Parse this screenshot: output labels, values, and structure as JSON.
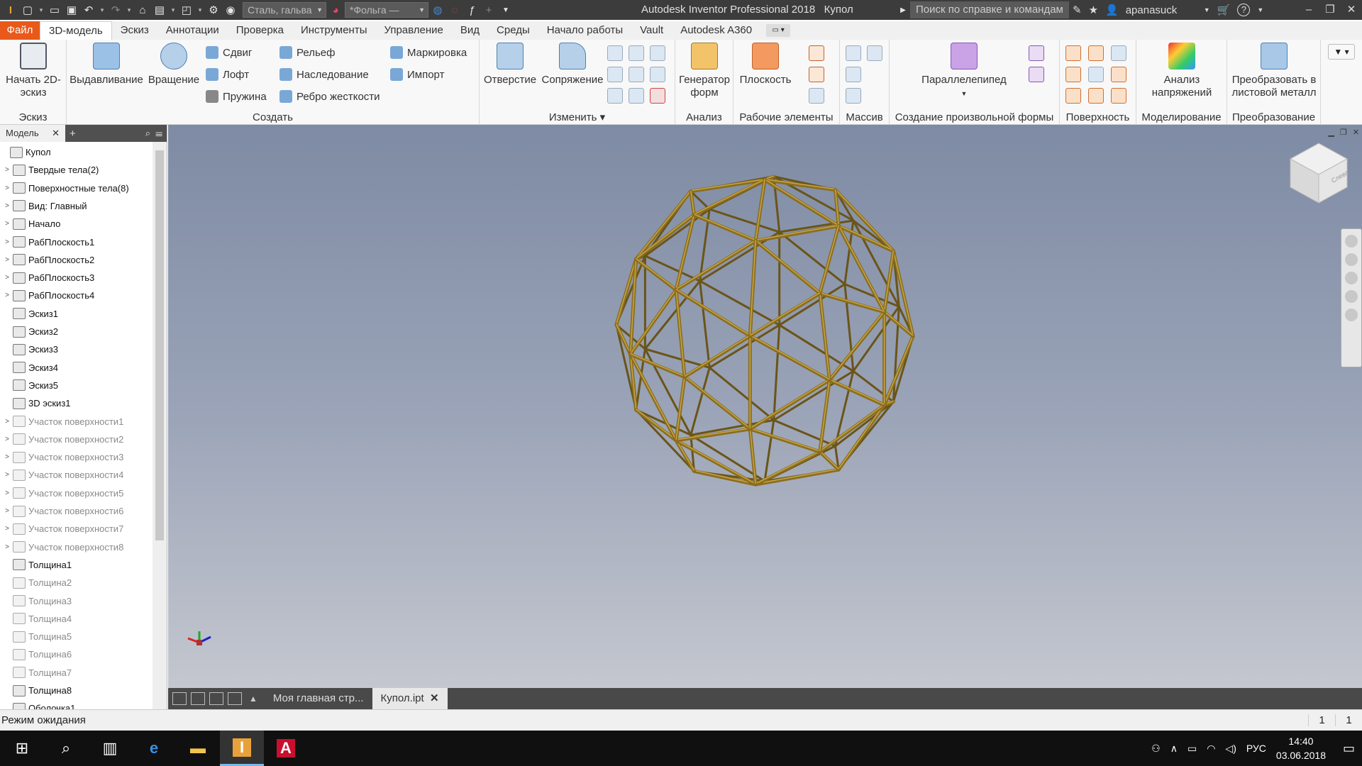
{
  "titlebar": {
    "app_title": "Autodesk Inventor Professional 2018",
    "document": "Купол",
    "material": "Сталь, гальва",
    "appearance": "*Фольга —",
    "search_placeholder": "Поиск по справке и командам",
    "user": "apanasuck",
    "help": "?",
    "quick_access_icons": [
      "new-icon",
      "open-icon",
      "save-icon",
      "undo-icon",
      "redo-icon",
      "home-icon",
      "folder-icon",
      "ilogic-icon",
      "update-icon",
      "globe-icon"
    ]
  },
  "menu": {
    "tabs": [
      "Файл",
      "3D-модель",
      "Эскиз",
      "Аннотации",
      "Проверка",
      "Инструменты",
      "Управление",
      "Вид",
      "Среды",
      "Начало работы",
      "Vault",
      "Autodesk A360"
    ],
    "active_tab": "3D-модель"
  },
  "ribbon": {
    "sketch_panel": {
      "title": "Эскиз",
      "start_2d": "Начать 2D-эскиз"
    },
    "create_panel": {
      "title": "Создать",
      "extrude": "Выдавливание",
      "revolve": "Вращение",
      "small": [
        "Сдвиг",
        "Лофт",
        "Пружина",
        "Рельеф",
        "Наследование",
        "Ребро жесткости",
        "Маркировка",
        "Импорт"
      ]
    },
    "modify_panel": {
      "title": "Изменить",
      "hole": "Отверстие",
      "fillet": "Сопряжение"
    },
    "analysis_panel": {
      "title": "Анализ",
      "shape_generator": "Генератор форм"
    },
    "work_features_panel": {
      "title": "Рабочие элементы",
      "plane": "Плоскость"
    },
    "pattern_panel": {
      "title": "Массив"
    },
    "freeform_panel": {
      "title": "Создание произвольной формы",
      "box": "Параллелепипед"
    },
    "surface_panel": {
      "title": "Поверхность"
    },
    "simulation_panel": {
      "title": "Моделирование",
      "stress": "Анализ напряжений"
    },
    "convert_panel": {
      "title": "Преобразование",
      "sheet_metal": "Преобразовать в листовой металл"
    }
  },
  "browser": {
    "tab": "Модель",
    "items": [
      {
        "label": "Купол",
        "grey": false,
        "expand": false,
        "indent": 0
      },
      {
        "label": "Твердые тела(2)",
        "grey": false,
        "expand": true,
        "indent": 1
      },
      {
        "label": "Поверхностные тела(8)",
        "grey": false,
        "expand": true,
        "indent": 1
      },
      {
        "label": "Вид: Главный",
        "grey": false,
        "expand": true,
        "indent": 1
      },
      {
        "label": "Начало",
        "grey": false,
        "expand": true,
        "indent": 1
      },
      {
        "label": "РабПлоскость1",
        "grey": false,
        "expand": true,
        "indent": 1
      },
      {
        "label": "РабПлоскость2",
        "grey": false,
        "expand": true,
        "indent": 1
      },
      {
        "label": "РабПлоскость3",
        "grey": false,
        "expand": true,
        "indent": 1
      },
      {
        "label": "РабПлоскость4",
        "grey": false,
        "expand": true,
        "indent": 1
      },
      {
        "label": "Эскиз1",
        "grey": false,
        "expand": false,
        "indent": 1
      },
      {
        "label": "Эскиз2",
        "grey": false,
        "expand": false,
        "indent": 1
      },
      {
        "label": "Эскиз3",
        "grey": false,
        "expand": false,
        "indent": 1
      },
      {
        "label": "Эскиз4",
        "grey": false,
        "expand": false,
        "indent": 1
      },
      {
        "label": "Эскиз5",
        "grey": false,
        "expand": false,
        "indent": 1
      },
      {
        "label": "3D эскиз1",
        "grey": false,
        "expand": false,
        "indent": 1
      },
      {
        "label": "Участок поверхности1",
        "grey": true,
        "expand": true,
        "indent": 1
      },
      {
        "label": "Участок поверхности2",
        "grey": true,
        "expand": true,
        "indent": 1
      },
      {
        "label": "Участок поверхности3",
        "grey": true,
        "expand": true,
        "indent": 1
      },
      {
        "label": "Участок поверхности4",
        "grey": true,
        "expand": true,
        "indent": 1
      },
      {
        "label": "Участок поверхности5",
        "grey": true,
        "expand": true,
        "indent": 1
      },
      {
        "label": "Участок поверхности6",
        "grey": true,
        "expand": true,
        "indent": 1
      },
      {
        "label": "Участок поверхности7",
        "grey": true,
        "expand": true,
        "indent": 1
      },
      {
        "label": "Участок поверхности8",
        "grey": true,
        "expand": true,
        "indent": 1
      },
      {
        "label": "Толщина1",
        "grey": false,
        "expand": false,
        "indent": 1
      },
      {
        "label": "Толщина2",
        "grey": true,
        "expand": false,
        "indent": 1
      },
      {
        "label": "Толщина3",
        "grey": true,
        "expand": false,
        "indent": 1
      },
      {
        "label": "Толщина4",
        "grey": true,
        "expand": false,
        "indent": 1
      },
      {
        "label": "Толщина5",
        "grey": true,
        "expand": false,
        "indent": 1
      },
      {
        "label": "Толщина6",
        "grey": true,
        "expand": false,
        "indent": 1
      },
      {
        "label": "Толщина7",
        "grey": true,
        "expand": false,
        "indent": 1
      },
      {
        "label": "Толщина8",
        "grey": false,
        "expand": false,
        "indent": 1
      },
      {
        "label": "Оболочка1",
        "grey": false,
        "expand": false,
        "indent": 1
      }
    ]
  },
  "viewport": {
    "viewcube_face": "Слева",
    "model_color": "#8a6d1e"
  },
  "doc_tabs": [
    "Моя главная стр...",
    "Купол.ipt"
  ],
  "status": {
    "text": "Режим ожидания",
    "count1": "1",
    "count2": "1"
  },
  "taskbar": {
    "lang": "РУС",
    "time": "14:40",
    "date": "03.06.2018"
  }
}
